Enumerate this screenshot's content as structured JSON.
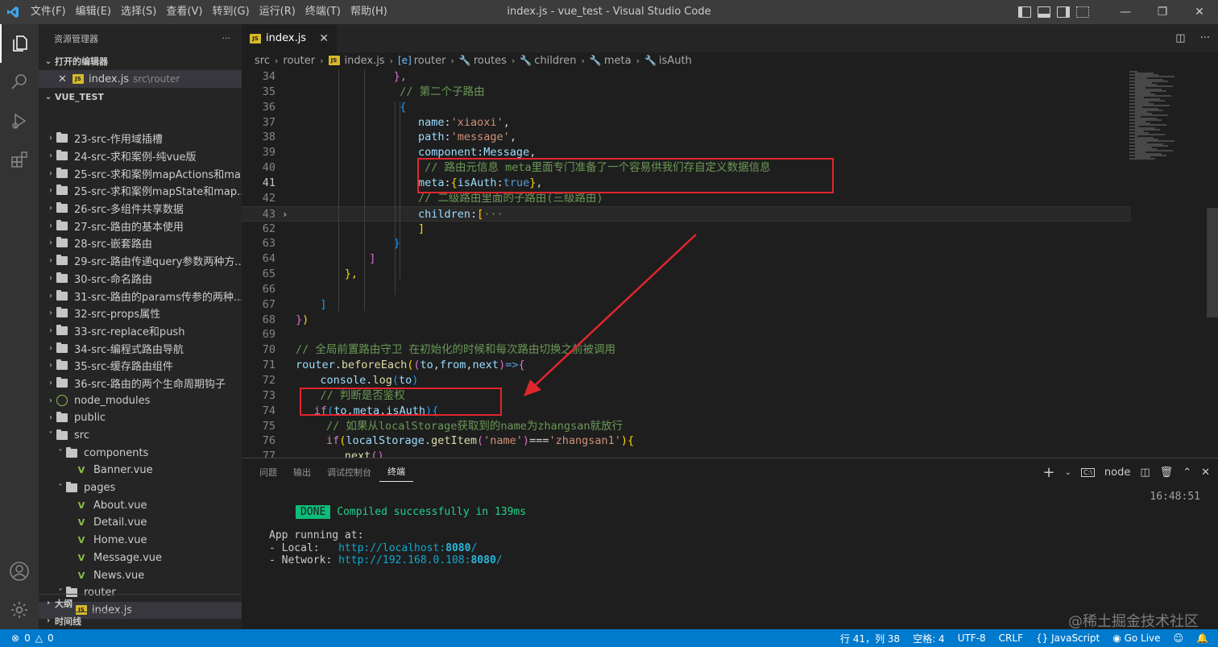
{
  "window": {
    "title": "index.js - vue_test - Visual Studio Code",
    "menu": [
      "文件(F)",
      "编辑(E)",
      "选择(S)",
      "查看(V)",
      "转到(G)",
      "运行(R)",
      "终端(T)",
      "帮助(H)"
    ]
  },
  "sidebar": {
    "title": "资源管理器",
    "more": "···",
    "open_editors_label": "打开的编辑器",
    "open_editor_file": "index.js",
    "open_editor_path": "src\\router",
    "project_label": "VUE_TEST",
    "tree": [
      {
        "label": "23-src-作用域插槽",
        "type": "folder",
        "depth": 1,
        "open": false
      },
      {
        "label": "24-src-求和案例-纯vue版",
        "type": "folder",
        "depth": 1,
        "open": false
      },
      {
        "label": "25-src-求和案例mapActions和ma...",
        "type": "folder",
        "depth": 1,
        "open": false
      },
      {
        "label": "25-src-求和案例mapState和map...",
        "type": "folder",
        "depth": 1,
        "open": false
      },
      {
        "label": "26-src-多组件共享数据",
        "type": "folder",
        "depth": 1,
        "open": false
      },
      {
        "label": "27-src-路由的基本使用",
        "type": "folder",
        "depth": 1,
        "open": false
      },
      {
        "label": "28-src-嵌套路由",
        "type": "folder",
        "depth": 1,
        "open": false
      },
      {
        "label": "29-src-路由传递query参数两种方...",
        "type": "folder",
        "depth": 1,
        "open": false
      },
      {
        "label": "30-src-命名路由",
        "type": "folder",
        "depth": 1,
        "open": false
      },
      {
        "label": "31-src-路由的params传参的两种...",
        "type": "folder",
        "depth": 1,
        "open": false
      },
      {
        "label": "32-src-props属性",
        "type": "folder",
        "depth": 1,
        "open": false
      },
      {
        "label": "33-src-replace和push",
        "type": "folder",
        "depth": 1,
        "open": false
      },
      {
        "label": "34-src-编程式路由导航",
        "type": "folder",
        "depth": 1,
        "open": false
      },
      {
        "label": "35-src-缓存路由组件",
        "type": "folder",
        "depth": 1,
        "open": false
      },
      {
        "label": "36-src-路由的两个生命周期钩子",
        "type": "folder",
        "depth": 1,
        "open": false
      },
      {
        "label": "node_modules",
        "type": "node",
        "depth": 1,
        "open": false
      },
      {
        "label": "public",
        "type": "folder",
        "depth": 1,
        "open": false
      },
      {
        "label": "src",
        "type": "folder",
        "depth": 1,
        "open": true
      },
      {
        "label": "components",
        "type": "folder",
        "depth": 2,
        "open": true
      },
      {
        "label": "Banner.vue",
        "type": "vue",
        "depth": 3
      },
      {
        "label": "pages",
        "type": "folder",
        "depth": 2,
        "open": true
      },
      {
        "label": "About.vue",
        "type": "vue",
        "depth": 3
      },
      {
        "label": "Detail.vue",
        "type": "vue",
        "depth": 3
      },
      {
        "label": "Home.vue",
        "type": "vue",
        "depth": 3
      },
      {
        "label": "Message.vue",
        "type": "vue",
        "depth": 3
      },
      {
        "label": "News.vue",
        "type": "vue",
        "depth": 3
      },
      {
        "label": "router",
        "type": "folder",
        "depth": 2,
        "open": true
      },
      {
        "label": "index.js",
        "type": "js",
        "depth": 3,
        "selected": true
      }
    ],
    "outline_label": "大纲",
    "timeline_label": "时间线"
  },
  "editor": {
    "tab_label": "index.js",
    "breadcrumb": [
      "src",
      "router",
      "index.js",
      "router",
      "routes",
      "children",
      "meta",
      "isAuth"
    ],
    "lines": [
      {
        "n": "34",
        "indent": 16,
        "code": [
          [
            "},",
            "c-b2"
          ]
        ]
      },
      {
        "n": "35",
        "indent": 17,
        "code": [
          [
            "// 第二个子路由",
            "c-cm"
          ]
        ]
      },
      {
        "n": "36",
        "indent": 17,
        "code": [
          [
            "{",
            "c-b3"
          ]
        ]
      },
      {
        "n": "37",
        "indent": 20,
        "code": [
          [
            "name",
            "c-prop"
          ],
          [
            ":",
            ""
          ],
          [
            "'xiaoxi'",
            "c-str"
          ],
          [
            ",",
            ""
          ]
        ]
      },
      {
        "n": "38",
        "indent": 20,
        "code": [
          [
            "path",
            "c-prop"
          ],
          [
            ":",
            ""
          ],
          [
            "'message'",
            "c-str"
          ],
          [
            ",",
            ""
          ]
        ]
      },
      {
        "n": "39",
        "indent": 20,
        "code": [
          [
            "component",
            "c-prop"
          ],
          [
            ":",
            ""
          ],
          [
            "Message",
            "c-prop"
          ],
          [
            ",",
            ""
          ]
        ]
      },
      {
        "n": "40",
        "indent": 20,
        "code": [
          [
            " // 路由元信息 meta里面专门准备了一个容易供我们存自定义数据信息",
            "c-cm"
          ]
        ]
      },
      {
        "n": "41",
        "indent": 20,
        "current": true,
        "code": [
          [
            "meta",
            "c-prop"
          ],
          [
            ":",
            ""
          ],
          [
            "{",
            "c-b1"
          ],
          [
            "isAuth",
            "c-prop"
          ],
          [
            ":",
            ""
          ],
          [
            "true",
            "c-kw"
          ],
          [
            "}",
            "c-b1"
          ],
          [
            ",",
            ""
          ]
        ]
      },
      {
        "n": "42",
        "indent": 20,
        "code": [
          [
            "// 二级路由里面的子路由(三级路由)",
            "c-cm"
          ]
        ]
      },
      {
        "n": "43",
        "indent": 20,
        "fold": true,
        "hl": true,
        "code": [
          [
            "children",
            "c-prop"
          ],
          [
            ":",
            ""
          ],
          [
            "[",
            "c-b1"
          ],
          [
            "···",
            "c-cm"
          ]
        ]
      },
      {
        "n": "62",
        "indent": 20,
        "code": [
          [
            "]",
            "c-b1"
          ]
        ]
      },
      {
        "n": "63",
        "indent": 16,
        "code": [
          [
            "}",
            "c-b3"
          ]
        ]
      },
      {
        "n": "64",
        "indent": 12,
        "code": [
          [
            "]",
            "c-b2"
          ]
        ]
      },
      {
        "n": "65",
        "indent": 8,
        "code": [
          [
            "},",
            "c-b1"
          ]
        ]
      },
      {
        "n": "66",
        "indent": 0,
        "code": []
      },
      {
        "n": "67",
        "indent": 4,
        "code": [
          [
            "]",
            "c-b3"
          ]
        ]
      },
      {
        "n": "68",
        "indent": 0,
        "code": [
          [
            "}",
            "c-b2"
          ],
          [
            ")",
            "c-b1"
          ]
        ]
      },
      {
        "n": "69",
        "indent": 0,
        "code": []
      },
      {
        "n": "70",
        "indent": 0,
        "code": [
          [
            "// 全局前置路由守卫 在初始化的时候和每次路由切换之前被调用",
            "c-cm"
          ]
        ]
      },
      {
        "n": "71",
        "indent": 0,
        "code": [
          [
            "router",
            "c-prop"
          ],
          [
            ".",
            ""
          ],
          [
            "beforeEach",
            "c-fn"
          ],
          [
            "(",
            "c-b1"
          ],
          [
            "(",
            "c-b2"
          ],
          [
            "to",
            "c-prop"
          ],
          [
            ",",
            ""
          ],
          [
            "from",
            "c-prop"
          ],
          [
            ",",
            ""
          ],
          [
            "next",
            "c-prop"
          ],
          [
            ")",
            "c-b2"
          ],
          [
            "=>",
            "c-kw"
          ],
          [
            "{",
            "c-b2"
          ]
        ]
      },
      {
        "n": "72",
        "indent": 4,
        "code": [
          [
            "console",
            "c-prop"
          ],
          [
            ".",
            ""
          ],
          [
            "log",
            "c-fn"
          ],
          [
            "(",
            "c-b3"
          ],
          [
            "to",
            "c-prop"
          ],
          [
            ")",
            "c-b3"
          ]
        ]
      },
      {
        "n": "73",
        "indent": 4,
        "code": [
          [
            "// 判断是否鉴权",
            "c-cm"
          ]
        ]
      },
      {
        "n": "74",
        "indent": 3,
        "code": [
          [
            "if",
            "c-ctl"
          ],
          [
            "(",
            "c-b3"
          ],
          [
            "to",
            "c-prop"
          ],
          [
            ".",
            ""
          ],
          [
            "meta",
            "c-prop"
          ],
          [
            ".",
            ""
          ],
          [
            "isAuth",
            "c-prop"
          ],
          [
            ")",
            "c-b3"
          ],
          [
            "{",
            "c-b3"
          ]
        ]
      },
      {
        "n": "75",
        "indent": 5,
        "code": [
          [
            "// 如果从localStorage获取到的name为zhangsan就放行",
            "c-cm"
          ]
        ]
      },
      {
        "n": "76",
        "indent": 5,
        "code": [
          [
            "if",
            "c-ctl"
          ],
          [
            "(",
            "c-b1"
          ],
          [
            "localStorage",
            "c-prop"
          ],
          [
            ".",
            ""
          ],
          [
            "getItem",
            "c-fn"
          ],
          [
            "(",
            "c-b2"
          ],
          [
            "'name'",
            "c-str"
          ],
          [
            ")",
            "c-b2"
          ],
          [
            "===",
            ""
          ],
          [
            "'zhangsan1'",
            "c-str"
          ],
          [
            ")",
            "c-b1"
          ],
          [
            "{",
            "c-b1"
          ]
        ]
      },
      {
        "n": "77",
        "indent": 8,
        "code": [
          [
            "next",
            "c-fn"
          ],
          [
            "()",
            "c-b2"
          ]
        ]
      }
    ]
  },
  "panel": {
    "tabs": [
      "问题",
      "输出",
      "调试控制台",
      "终端"
    ],
    "active_tab": "终端",
    "terminal_name": "node",
    "done_badge": "DONE",
    "compiled_msg": "Compiled successfully in 139ms",
    "time": "16:48:51",
    "running_label": "App running at:",
    "local_label": "- Local:   ",
    "local_url": "http://localhost:",
    "local_port": "8080",
    "local_tail": "/",
    "network_label": "- Network: ",
    "network_url": "http://192.168.0.108:",
    "network_port": "8080",
    "network_tail": "/"
  },
  "statusbar": {
    "errors": "0",
    "warnings": "0",
    "position": "行 41，列 38",
    "spaces": "空格: 4",
    "encoding": "UTF-8",
    "eol": "CRLF",
    "language": "JavaScript",
    "golive": "Go Live"
  },
  "watermark": "@稀土掘金技术社区",
  "colors": {
    "accent": "#007acc",
    "highlight_box": "#e0262d"
  }
}
